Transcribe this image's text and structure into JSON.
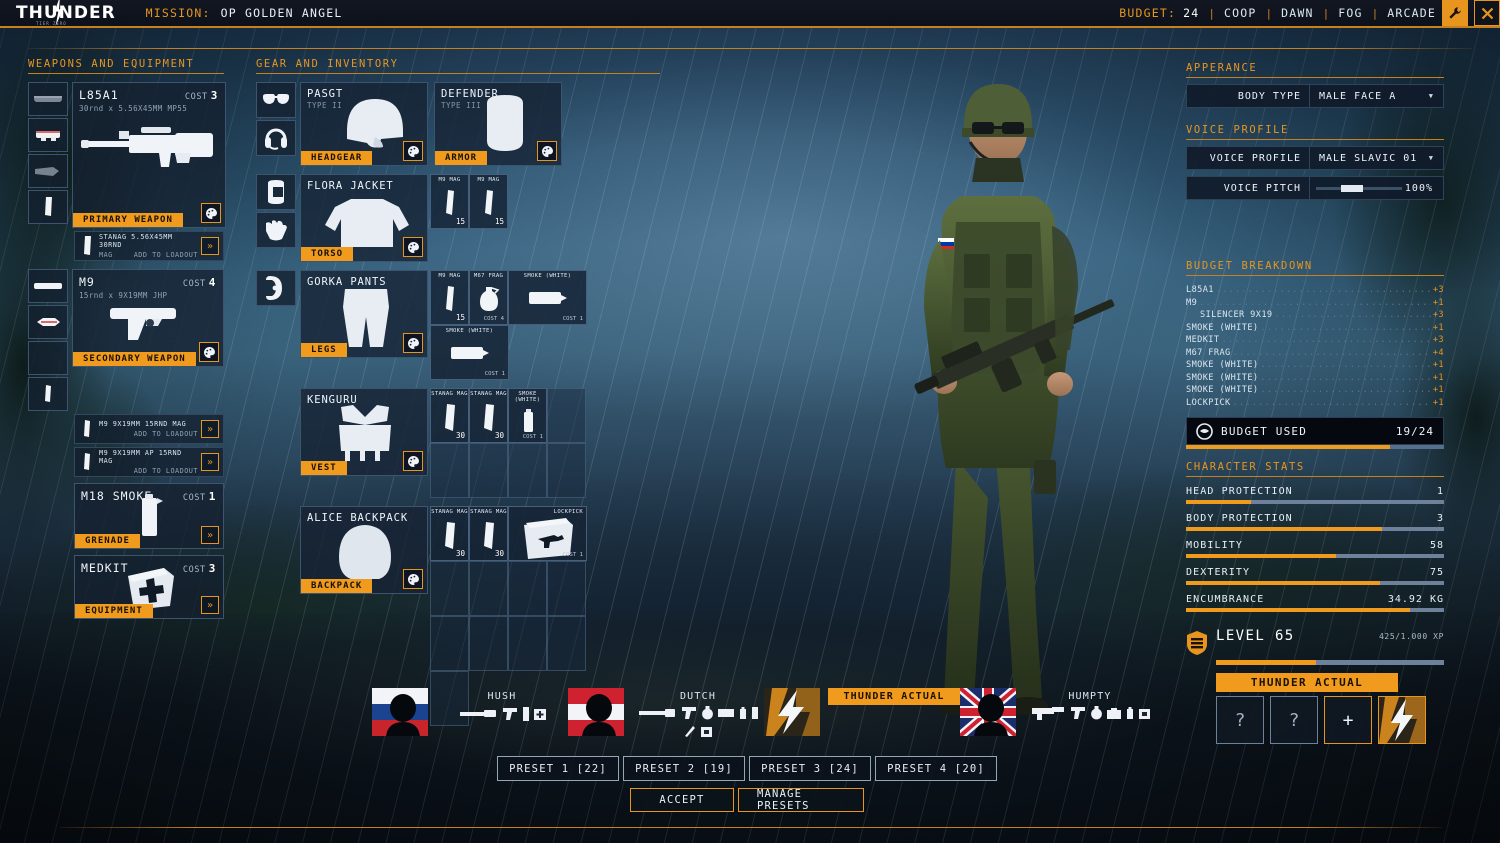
{
  "topbar": {
    "brand": "THUNDER",
    "brand_sub": "TIER ZERO",
    "mission_label": "MISSION:",
    "mission_name": "OP GOLDEN ANGEL",
    "budget_label": "BUDGET:",
    "budget_value": "24",
    "chips": [
      "COOP",
      "DAWN",
      "FOG",
      "ARCADE"
    ],
    "settings_icon": "wrench-icon",
    "close_icon": "close-icon",
    "accent": "#e8951f"
  },
  "weapons_panel": {
    "title": "WEAPONS AND EQUIPMENT",
    "primary": {
      "name": "L85A1",
      "desc": "30rnd x 5.56X45MM MP55",
      "cost_label": "COST",
      "cost": "3",
      "tag": "PRIMARY WEAPON",
      "paint_icon": "paint-palette-icon",
      "attachments": [
        "suppressor-slot",
        "optic-slot",
        "grip-slot",
        "magazine-slot"
      ]
    },
    "primary_ammo": [
      {
        "line1": "STANAG 5.56X45MM 30RND",
        "line2": "MAG",
        "action": "ADD TO LOADOUT"
      }
    ],
    "secondary": {
      "name": "M9",
      "desc": "15rnd x 9X19MM JHP",
      "cost_label": "COST",
      "cost": "4",
      "tag": "SECONDARY WEAPON",
      "paint_icon": "paint-palette-icon",
      "attachments": [
        "suppressor-slot",
        "optic-slot",
        "empty-slot",
        "magazine-slot"
      ]
    },
    "secondary_ammo": [
      {
        "line1": "M9 9X19MM 15RND MAG",
        "line2": "",
        "action": "ADD TO LOADOUT"
      },
      {
        "line1": "M9 9X19MM AP 15RND MAG",
        "line2": "",
        "action": "ADD TO LOADOUT"
      }
    ],
    "grenade": {
      "name": "M18 SMOKE",
      "cost_label": "COST",
      "cost": "1",
      "tag": "GRENADE"
    },
    "equipment": {
      "name": "MEDKIT",
      "cost_label": "COST",
      "cost": "3",
      "tag": "EQUIPMENT"
    }
  },
  "gear_panel": {
    "title": "GEAR AND INVENTORY",
    "accessories": [
      "glasses-icon",
      "headset-icon",
      "balaclava-icon",
      "gloves-icon",
      "kneepads-icon"
    ],
    "slots": [
      {
        "name": "PASGT",
        "sub": "TYPE II",
        "tag": "HEADGEAR",
        "art": "helmet-icon"
      },
      {
        "name": "DEFENDER",
        "sub": "TYPE III",
        "tag": "ARMOR",
        "art": "plate-icon"
      },
      {
        "name": "FLORA JACKET",
        "sub": "",
        "tag": "TORSO",
        "art": "jacket-icon"
      },
      {
        "name": "GORKA PANTS",
        "sub": "",
        "tag": "LEGS",
        "art": "pants-icon"
      },
      {
        "name": "KENGURU",
        "sub": "",
        "tag": "VEST",
        "art": "vest-icon"
      },
      {
        "name": "ALICE BACKPACK",
        "sub": "",
        "tag": "BACKPACK",
        "art": "backpack-icon"
      }
    ],
    "pouch_grid": [
      {
        "name": "M9 MAG",
        "qty": "15",
        "art": "pistol-mag-icon"
      },
      {
        "name": "M9 MAG",
        "qty": "15",
        "art": "pistol-mag-icon"
      }
    ],
    "belt_grid": [
      {
        "name": "M9 MAG",
        "qty": "15",
        "art": "pistol-mag-icon"
      },
      {
        "name": "M67 FRAG",
        "cost": "COST 4",
        "art": "frag-icon"
      },
      {
        "name": "SMOKE (WHITE)",
        "cost": "COST 1",
        "art": "smoke-icon"
      },
      {
        "name": "SMOKE (WHITE)",
        "cost": "COST 1",
        "art": "smoke-icon"
      }
    ],
    "vest_grid": [
      {
        "name": "STANAG MAG",
        "qty": "30",
        "art": "rifle-mag-icon"
      },
      {
        "name": "STANAG MAG",
        "qty": "30",
        "art": "rifle-mag-icon"
      },
      {
        "name": "SMOKE (WHITE)",
        "cost": "COST 1",
        "art": "smoke-icon"
      },
      {
        "name": "",
        "art": ""
      },
      {
        "name": "",
        "art": ""
      },
      {
        "name": "",
        "art": ""
      },
      {
        "name": "",
        "art": ""
      },
      {
        "name": "",
        "art": ""
      }
    ],
    "backpack_grid": [
      {
        "name": "STANAG MAG",
        "qty": "30",
        "art": "rifle-mag-icon"
      },
      {
        "name": "STANAG MAG",
        "qty": "30",
        "art": "rifle-mag-icon"
      },
      {
        "name": "LOCKPICK",
        "cost": "COST 1",
        "art": "lockpick-icon",
        "wide": true
      }
    ]
  },
  "appearance": {
    "title": "APPERANCE",
    "body_type_label": "BODY TYPE",
    "body_type_value": "MALE FACE A"
  },
  "voice": {
    "title": "VOICE PROFILE",
    "profile_label": "VOICE PROFILE",
    "profile_value": "MALE SLAVIC 01",
    "pitch_label": "VOICE PITCH",
    "pitch_value": "100%",
    "pitch_percent": 40
  },
  "budget_breakdown": {
    "title": "BUDGET BREAKDOWN",
    "items": [
      {
        "name": "L85A1",
        "cost": "+3",
        "indent": false
      },
      {
        "name": "M9",
        "cost": "+1",
        "indent": false
      },
      {
        "name": "SILENCER 9X19",
        "cost": "+3",
        "indent": true
      },
      {
        "name": "SMOKE (WHITE)",
        "cost": "+1",
        "indent": false
      },
      {
        "name": "MEDKIT",
        "cost": "+3",
        "indent": false
      },
      {
        "name": "M67 FRAG",
        "cost": "+4",
        "indent": false
      },
      {
        "name": "SMOKE (WHITE)",
        "cost": "+1",
        "indent": false
      },
      {
        "name": "SMOKE (WHITE)",
        "cost": "+1",
        "indent": false
      },
      {
        "name": "SMOKE (WHITE)",
        "cost": "+1",
        "indent": false
      },
      {
        "name": "LOCKPICK",
        "cost": "+1",
        "indent": false
      }
    ],
    "used_icon": "budget-icon",
    "used_label": "BUDGET USED",
    "used_value": "19/24",
    "used_percent": 79
  },
  "character_stats": {
    "title": "CHARACTER STATS",
    "rows": [
      {
        "name": "HEAD PROTECTION",
        "value": "1",
        "percent": 25
      },
      {
        "name": "BODY PROTECTION",
        "value": "3",
        "percent": 76
      },
      {
        "name": "MOBILITY",
        "value": "58",
        "percent": 58
      },
      {
        "name": "DEXTERITY",
        "value": "75",
        "percent": 75
      },
      {
        "name": "ENCUMBRANCE",
        "value": "34.92 KG",
        "percent": 87
      }
    ]
  },
  "level": {
    "shield_icon": "rank-shield-icon",
    "label": "LEVEL 65",
    "xp": "425/1.000 XP",
    "xp_percent": 44,
    "squad_name": "THUNDER ACTUAL",
    "slots": [
      "?",
      "?",
      "+"
    ],
    "portrait_icon": "thunder-bolt-icon"
  },
  "squad": {
    "members": [
      {
        "name": "HUSH",
        "flag": "russia",
        "active": false,
        "kit": [
          "rifle-icon",
          "pistol-icon",
          "mag-icon",
          "medkit-icon"
        ]
      },
      {
        "name": "DUTCH",
        "flag": "austria",
        "active": false,
        "kit": [
          "shotgun-icon",
          "pistol-icon",
          "grenade-icon",
          "box-icon",
          "smoke-icon",
          "mag-icon",
          "knife-icon",
          "radio-icon"
        ]
      },
      {
        "name": "THUNDER ACTUAL",
        "flag": "thunder",
        "active": true,
        "kit": []
      },
      {
        "name": "HUMPTY",
        "flag": "uk",
        "active": false,
        "kit": [
          "smg-icon",
          "pistol-icon",
          "grenade-icon",
          "medkit-icon",
          "smoke-icon",
          "radio-icon"
        ]
      }
    ]
  },
  "presets": {
    "buttons": [
      "PRESET 1 [22]",
      "PRESET 2 [19]",
      "PRESET 3 [24]",
      "PRESET 4 [20]"
    ],
    "accept_label": "ACCEPT",
    "manage_label": "MANAGE PRESETS"
  }
}
